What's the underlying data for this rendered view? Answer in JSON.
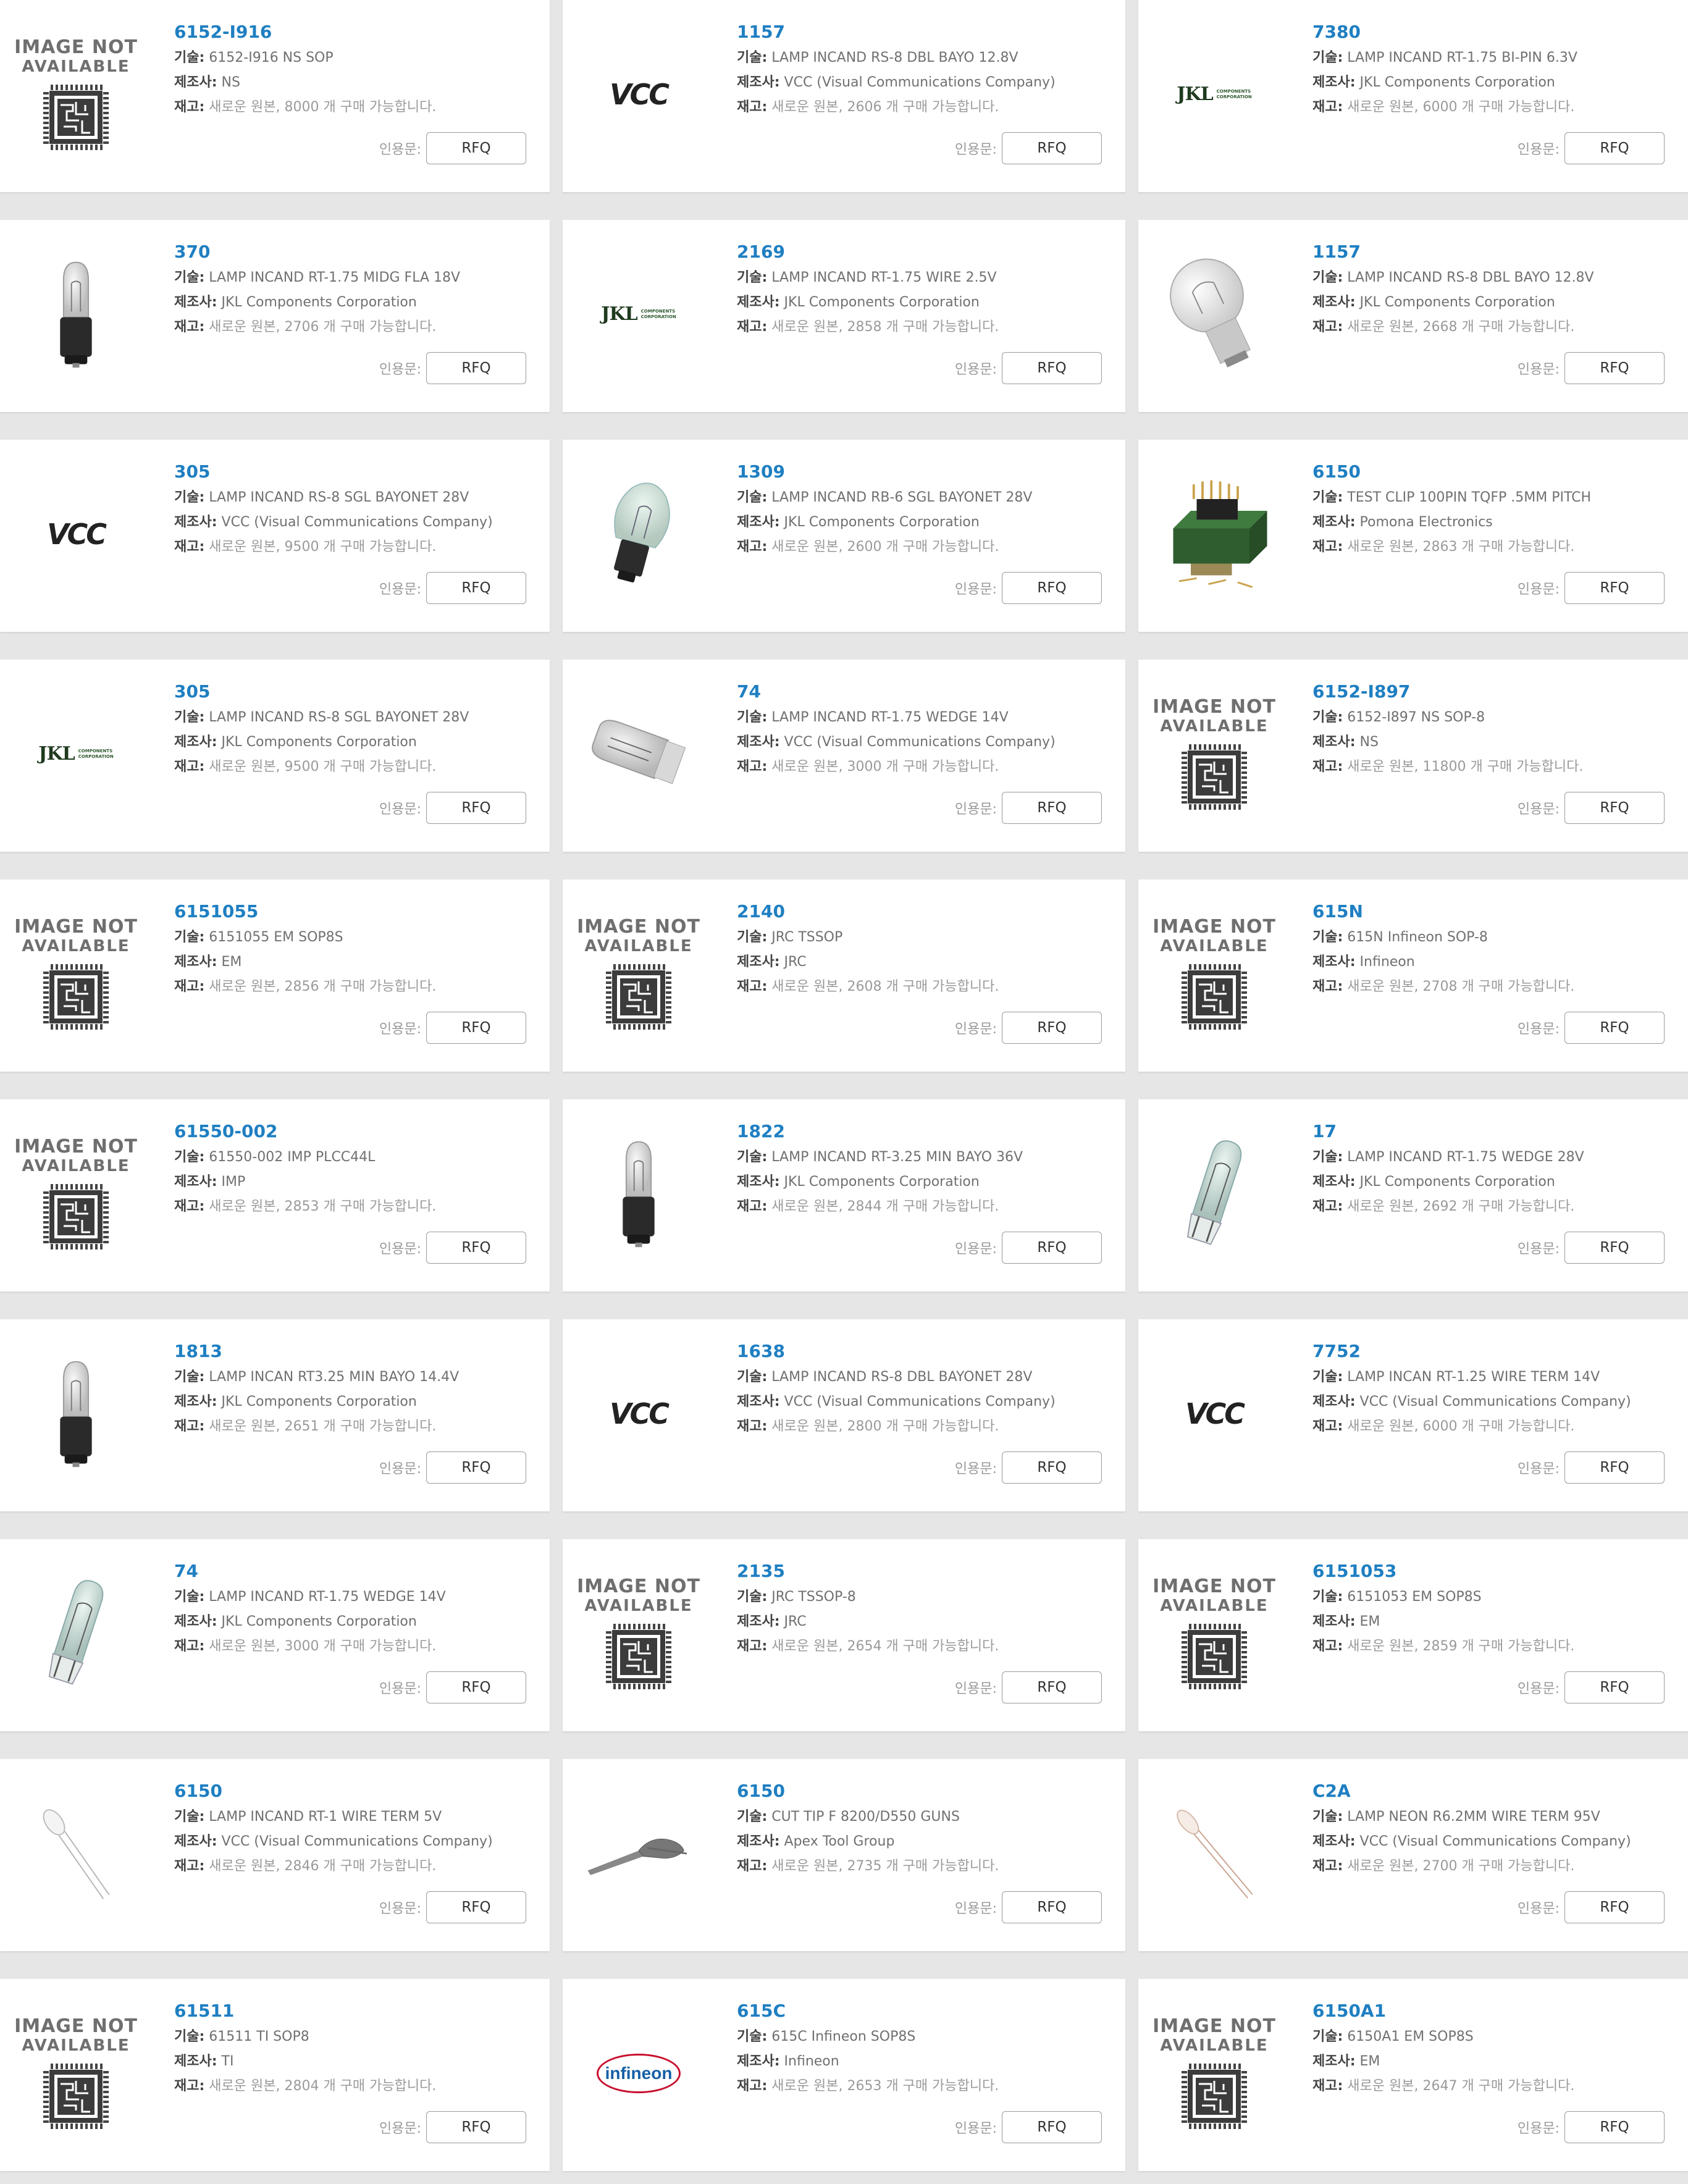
{
  "labels": {
    "desc": "기술:",
    "mfr": "제조사:",
    "stock": "재고:",
    "quote": "인용문:",
    "rfq": "RFQ",
    "na_line1": "IMAGE NOT",
    "na_line2": "AVAILABLE",
    "vcc_logo": "VCC",
    "jkl_logo": "JKL",
    "jkl_sub1": "COMPONENTS",
    "jkl_sub2": "CORPORATION",
    "infineon_logo": "infineon"
  },
  "products": [
    {
      "pn": "6152-I916",
      "desc": "6152-I916 NS SOP",
      "mfr": "NS",
      "stock": "새로운 원본, 8000 개 구매 가능합니다.",
      "image": "not-available"
    },
    {
      "pn": "1157",
      "desc": "LAMP INCAND RS-8 DBL BAYO 12.8V",
      "mfr": "VCC (Visual Communications Company)",
      "stock": "새로운 원본, 2606 개 구매 가능합니다.",
      "image": "vcc-logo"
    },
    {
      "pn": "7380",
      "desc": "LAMP INCAND RT-1.75 BI-PIN 6.3V",
      "mfr": "JKL Components Corporation",
      "stock": "새로운 원본, 6000 개 구매 가능합니다.",
      "image": "jkl-logo"
    },
    {
      "pn": "370",
      "desc": "LAMP INCAND RT-1.75 MIDG FLA 18V",
      "mfr": "JKL Components Corporation",
      "stock": "새로운 원본, 2706 개 구매 가능합니다.",
      "image": "bulb-midget"
    },
    {
      "pn": "2169",
      "desc": "LAMP INCAND RT-1.75 WIRE 2.5V",
      "mfr": "JKL Components Corporation",
      "stock": "새로운 원본, 2858 개 구매 가능합니다.",
      "image": "jkl-logo"
    },
    {
      "pn": "1157",
      "desc": "LAMP INCAND RS-8 DBL BAYO 12.8V",
      "mfr": "JKL Components Corporation",
      "stock": "새로운 원본, 2668 개 구매 가능합니다.",
      "image": "bulb-large"
    },
    {
      "pn": "305",
      "desc": "LAMP INCAND RS-8 SGL BAYONET 28V",
      "mfr": "VCC (Visual Communications Company)",
      "stock": "새로운 원본, 9500 개 구매 가능합니다.",
      "image": "vcc-logo"
    },
    {
      "pn": "1309",
      "desc": "LAMP INCAND RB-6 SGL BAYONET 28V",
      "mfr": "JKL Components Corporation",
      "stock": "새로운 원본, 2600 개 구매 가능합니다.",
      "image": "bulb-bayonet"
    },
    {
      "pn": "6150",
      "desc": "TEST CLIP 100PIN TQFP .5MM PITCH",
      "mfr": "Pomona Electronics",
      "stock": "새로운 원본, 2863 개 구매 가능합니다.",
      "image": "test-clip"
    },
    {
      "pn": "305",
      "desc": "LAMP INCAND RS-8 SGL BAYONET 28V",
      "mfr": "JKL Components Corporation",
      "stock": "새로운 원본, 9500 개 구매 가능합니다.",
      "image": "jkl-logo"
    },
    {
      "pn": "74",
      "desc": "LAMP INCAND RT-1.75 WEDGE 14V",
      "mfr": "VCC (Visual Communications Company)",
      "stock": "새로운 원본, 3000 개 구매 가능합니다.",
      "image": "bulb-wedge-flat"
    },
    {
      "pn": "6152-I897",
      "desc": "6152-I897 NS SOP-8",
      "mfr": "NS",
      "stock": "새로운 원본, 11800 개 구매 가능합니다.",
      "image": "not-available"
    },
    {
      "pn": "6151055",
      "desc": "6151055 EM SOP8S",
      "mfr": "EM",
      "stock": "새로운 원본, 2856 개 구매 가능합니다.",
      "image": "not-available"
    },
    {
      "pn": "2140",
      "desc": "JRC TSSOP",
      "mfr": "JRC",
      "stock": "새로운 원본, 2608 개 구매 가능합니다.",
      "image": "not-available"
    },
    {
      "pn": "615N",
      "desc": "615N Infineon SOP-8",
      "mfr": "Infineon",
      "stock": "새로운 원본, 2708 개 구매 가능합니다.",
      "image": "not-available"
    },
    {
      "pn": "61550-002",
      "desc": "61550-002 IMP PLCC44L",
      "mfr": "IMP",
      "stock": "새로운 원본, 2853 개 구매 가능합니다.",
      "image": "not-available"
    },
    {
      "pn": "1822",
      "desc": "LAMP INCAND RT-3.25 MIN BAYO 36V",
      "mfr": "JKL Components Corporation",
      "stock": "새로운 원본, 2844 개 구매 가능합니다.",
      "image": "bulb-midget"
    },
    {
      "pn": "17",
      "desc": "LAMP INCAND RT-1.75 WEDGE 28V",
      "mfr": "JKL Components Corporation",
      "stock": "새로운 원본, 2692 개 구매 가능합니다.",
      "image": "bulb-wedge"
    },
    {
      "pn": "1813",
      "desc": "LAMP INCAN RT3.25 MIN BAYO 14.4V",
      "mfr": "JKL Components Corporation",
      "stock": "새로운 원본, 2651 개 구매 가능합니다.",
      "image": "bulb-midget"
    },
    {
      "pn": "1638",
      "desc": "LAMP INCAND RS-8 DBL BAYONET 28V",
      "mfr": "VCC (Visual Communications Company)",
      "stock": "새로운 원본, 2800 개 구매 가능합니다.",
      "image": "vcc-logo"
    },
    {
      "pn": "7752",
      "desc": "LAMP INCAN RT-1.25 WIRE TERM 14V",
      "mfr": "VCC (Visual Communications Company)",
      "stock": "새로운 원본, 6000 개 구매 가능합니다.",
      "image": "vcc-logo"
    },
    {
      "pn": "74",
      "desc": "LAMP INCAND RT-1.75 WEDGE 14V",
      "mfr": "JKL Components Corporation",
      "stock": "새로운 원본, 3000 개 구매 가능합니다.",
      "image": "bulb-wedge"
    },
    {
      "pn": "2135",
      "desc": "JRC TSSOP-8",
      "mfr": "JRC",
      "stock": "새로운 원본, 2654 개 구매 가능합니다.",
      "image": "not-available"
    },
    {
      "pn": "6151053",
      "desc": "6151053 EM SOP8S",
      "mfr": "EM",
      "stock": "새로운 원본, 2859 개 구매 가능합니다.",
      "image": "not-available"
    },
    {
      "pn": "6150",
      "desc": "LAMP INCAND RT-1 WIRE TERM 5V",
      "mfr": "VCC (Visual Communications Company)",
      "stock": "새로운 원본, 2846 개 구매 가능합니다.",
      "image": "bulb-wire"
    },
    {
      "pn": "6150",
      "desc": "CUT TIP F 8200/D550 GUNS",
      "mfr": "Apex Tool Group",
      "stock": "새로운 원본, 2735 개 구매 가능합니다.",
      "image": "cut-tip"
    },
    {
      "pn": "C2A",
      "desc": "LAMP NEON R6.2MM WIRE TERM 95V",
      "mfr": "VCC (Visual Communications Company)",
      "stock": "새로운 원본, 2700 개 구매 가능합니다.",
      "image": "bulb-neon"
    },
    {
      "pn": "61511",
      "desc": "61511 TI SOP8",
      "mfr": "TI",
      "stock": "새로운 원본, 2804 개 구매 가능합니다.",
      "image": "not-available"
    },
    {
      "pn": "615C",
      "desc": "615C Infineon SOP8S",
      "mfr": "Infineon",
      "stock": "새로운 원본, 2653 개 구매 가능합니다.",
      "image": "infineon-logo"
    },
    {
      "pn": "6150A1",
      "desc": "6150A1 EM SOP8S",
      "mfr": "EM",
      "stock": "새로운 원본, 2647 개 구매 가능합니다.",
      "image": "not-available"
    }
  ]
}
